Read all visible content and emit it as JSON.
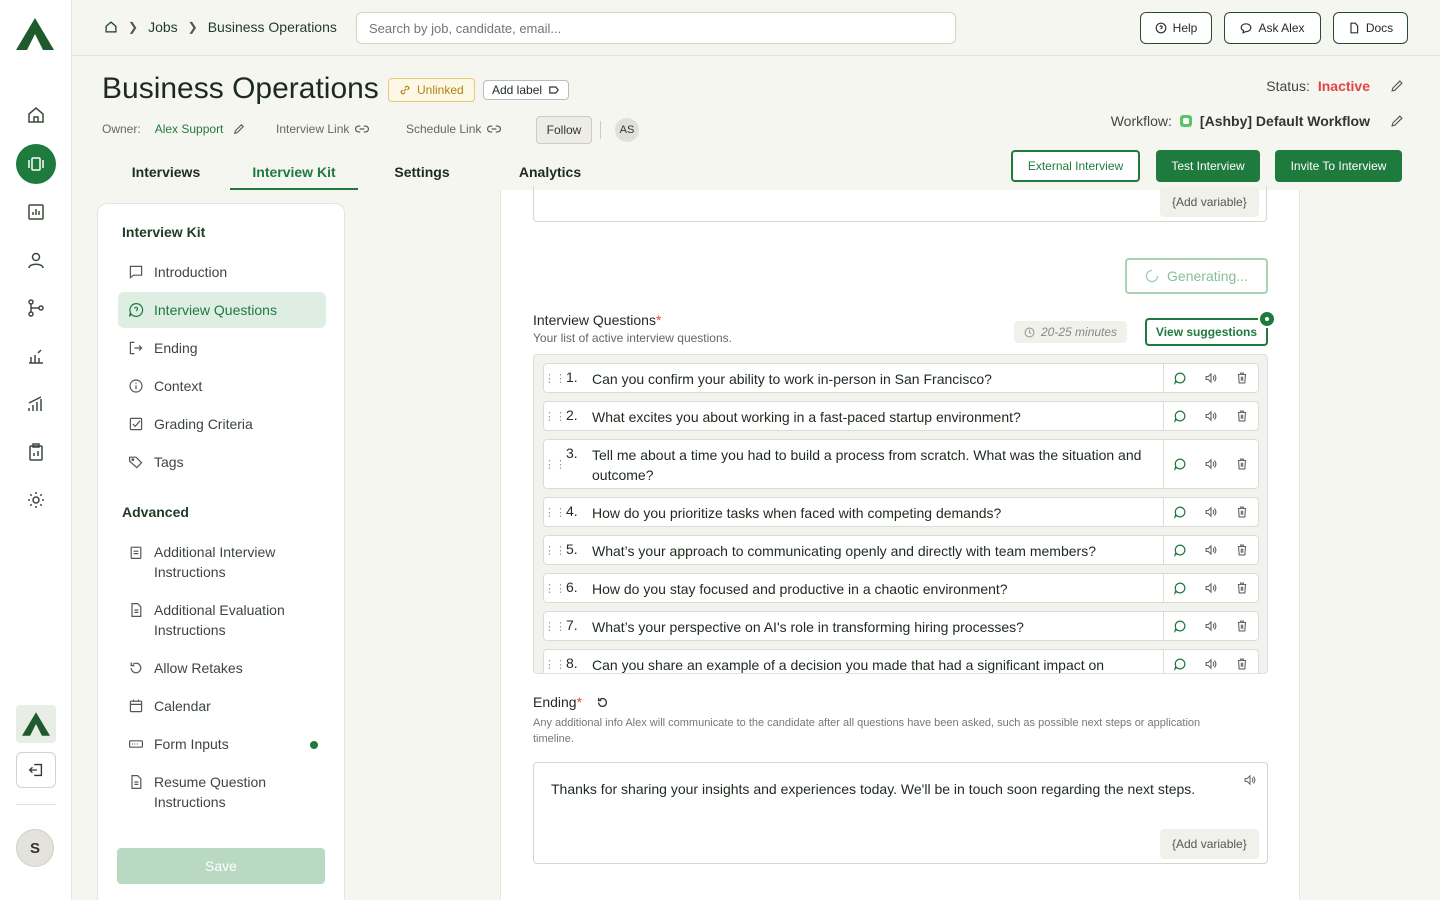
{
  "nav": {
    "home": "home-icon",
    "jobs": "jobs-icon",
    "reports": "reports-icon",
    "candidates": "person-icon",
    "workflows": "workflow-icon",
    "integrations": "integrations-icon",
    "analytics": "analytics-icon",
    "clipboard": "clipboard-icon",
    "settings": "gear-icon",
    "user_initial": "S"
  },
  "breadcrumb": {
    "jobs": "Jobs",
    "current": "Business Operations"
  },
  "search": {
    "placeholder": "Search by job, candidate, email..."
  },
  "topbar": {
    "help": "Help",
    "ask": "Ask Alex",
    "docs": "Docs"
  },
  "job": {
    "title": "Business Operations",
    "unlinked": "Unlinked",
    "add_label": "Add label",
    "owner_label": "Owner:",
    "owner": "Alex Support",
    "interview_link": "Interview Link",
    "schedule_link": "Schedule Link",
    "follow": "Follow",
    "initials": "AS",
    "status_label": "Status:",
    "status": "Inactive",
    "workflow_label": "Workflow:",
    "workflow": "[Ashby] Default Workflow"
  },
  "tabs": [
    "Interviews",
    "Interview Kit",
    "Settings",
    "Analytics"
  ],
  "actions": {
    "external": "External Interview",
    "test": "Test Interview",
    "invite": "Invite To Interview"
  },
  "sidebar": {
    "heading": "Interview Kit",
    "items": [
      "Introduction",
      "Interview Questions",
      "Ending",
      "Context",
      "Grading Criteria",
      "Tags"
    ],
    "advanced_heading": "Advanced",
    "advanced": [
      "Additional Interview Instructions",
      "Additional Evaluation Instructions",
      "Allow Retakes",
      "Calendar",
      "Form Inputs",
      "Resume Question Instructions"
    ],
    "save": "Save"
  },
  "main": {
    "add_variable": "{Add variable}",
    "generating": "Generating...",
    "questions_label": "Interview Questions",
    "required_mark": "*",
    "questions_sub": "Your list of active interview questions.",
    "duration": "20-25 minutes",
    "view_suggestions": "View suggestions",
    "questions": [
      {
        "n": "1.",
        "text": "Can you confirm your ability to work in-person in San Francisco?"
      },
      {
        "n": "2.",
        "text": "What excites you about working in a fast-paced startup environment?"
      },
      {
        "n": "3.",
        "text": "Tell me about a time you had to build a process from scratch. What was the situation and outcome?"
      },
      {
        "n": "4.",
        "text": "How do you prioritize tasks when faced with competing demands?"
      },
      {
        "n": "5.",
        "text": "What’s your approach to communicating openly and directly with team members?"
      },
      {
        "n": "6.",
        "text": "How do you stay focused and productive in a chaotic environment?"
      },
      {
        "n": "7.",
        "text": "What’s your perspective on AI's role in transforming hiring processes?"
      },
      {
        "n": "8.",
        "text": "Can you share an example of a decision you made that had a significant impact on"
      }
    ],
    "ending_label": "Ending",
    "ending_sub": "Any additional info Alex will communicate to the candidate after all questions have been asked, such as possible next steps or application timeline.",
    "ending_text": "Thanks for sharing your insights and experiences today. We'll be in touch soon regarding the next steps."
  }
}
